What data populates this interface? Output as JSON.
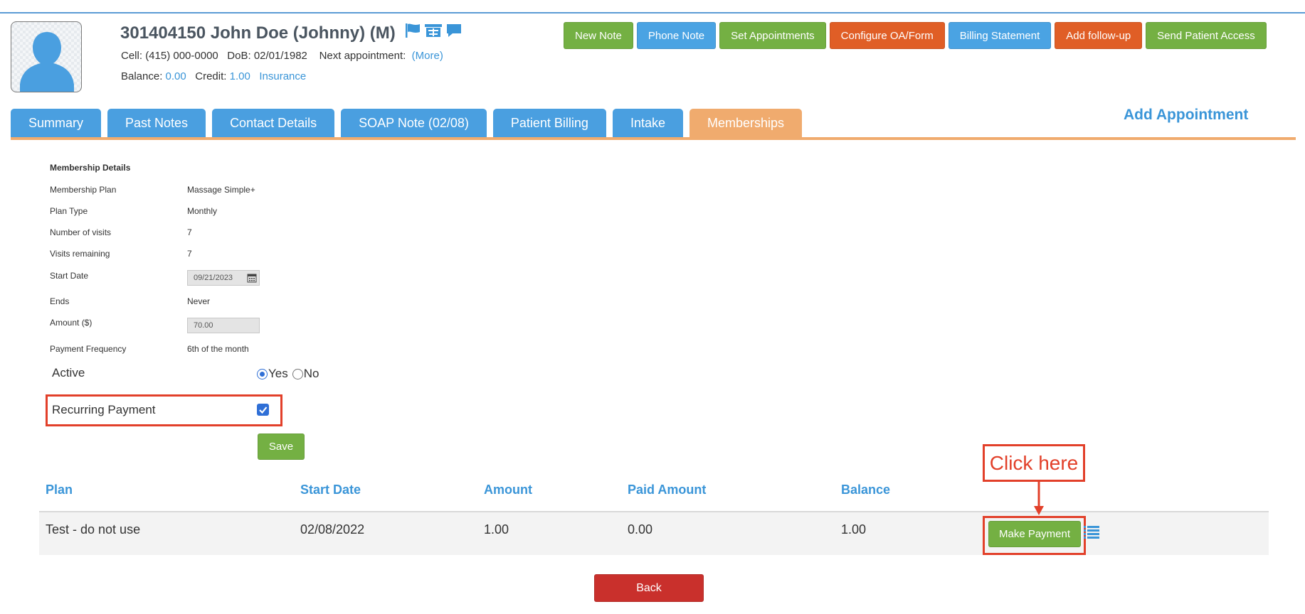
{
  "header": {
    "patient_id_name": "301404150 John Doe  (Johnny) (M)",
    "cell_label": "Cell:",
    "cell_value": "(415) 000-0000",
    "dob_label": "DoB:",
    "dob_value": "02/01/1982",
    "next_appt_label": "Next appointment:",
    "more_link": "(More)",
    "balance_label": "Balance:",
    "balance_value": "0.00",
    "credit_label": "Credit:",
    "credit_value": "1.00",
    "insurance_link": "Insurance",
    "icons": [
      "flag-icon",
      "cashier-icon",
      "chat-bubble-icon"
    ]
  },
  "actions": [
    {
      "label": "New Note",
      "color": "#74b043"
    },
    {
      "label": "Phone Note",
      "color": "#4aa3e3"
    },
    {
      "label": "Set Appointments",
      "color": "#74b043"
    },
    {
      "label": "Configure OA/Form",
      "color": "#e05e26"
    },
    {
      "label": "Billing Statement",
      "color": "#4aa3e3"
    },
    {
      "label": "Add follow-up",
      "color": "#e05e26"
    },
    {
      "label": "Send Patient Access",
      "color": "#74b043"
    }
  ],
  "tabs": [
    {
      "label": "Summary",
      "active": false
    },
    {
      "label": "Past Notes",
      "active": false
    },
    {
      "label": "Contact Details",
      "active": false
    },
    {
      "label": "SOAP Note (02/08)",
      "active": false
    },
    {
      "label": "Patient Billing",
      "active": false
    },
    {
      "label": "Intake",
      "active": false
    },
    {
      "label": "Memberships",
      "active": true
    }
  ],
  "add_appointment": "Add Appointment",
  "membership": {
    "title": "Membership Details",
    "plan_label": "Membership Plan",
    "plan_value": "Massage Simple+",
    "type_label": "Plan Type",
    "type_value": "Monthly",
    "visits_label": "Number of visits",
    "visits_value": "7",
    "remaining_label": "Visits remaining",
    "remaining_value": "7",
    "start_label": "Start Date",
    "start_value": "09/21/2023",
    "ends_label": "Ends",
    "ends_value": "Never",
    "amount_label": "Amount ($)",
    "amount_value": "70.00",
    "frequency_label": "Payment Frequency",
    "frequency_value": "6th of the month",
    "active_label": "Active",
    "active_yes": "Yes",
    "active_no": "No",
    "active_selected": "Yes",
    "recurring_label": "Recurring Payment",
    "recurring_checked": true,
    "save_label": "Save"
  },
  "table": {
    "headers": [
      "Plan",
      "Start Date",
      "Amount",
      "Paid Amount",
      "Balance"
    ],
    "rows": [
      {
        "plan": "Test - do not use",
        "start": "02/08/2022",
        "amount": "1.00",
        "paid": "0.00",
        "balance": "1.00"
      }
    ],
    "make_payment_label": "Make Payment"
  },
  "callout": "Click here",
  "back_label": "Back",
  "colors": {
    "accent_blue": "#4a9fe0",
    "active_tab": "#f0ab6e",
    "annotation_red": "#e2402a",
    "back_red": "#c9302c"
  }
}
